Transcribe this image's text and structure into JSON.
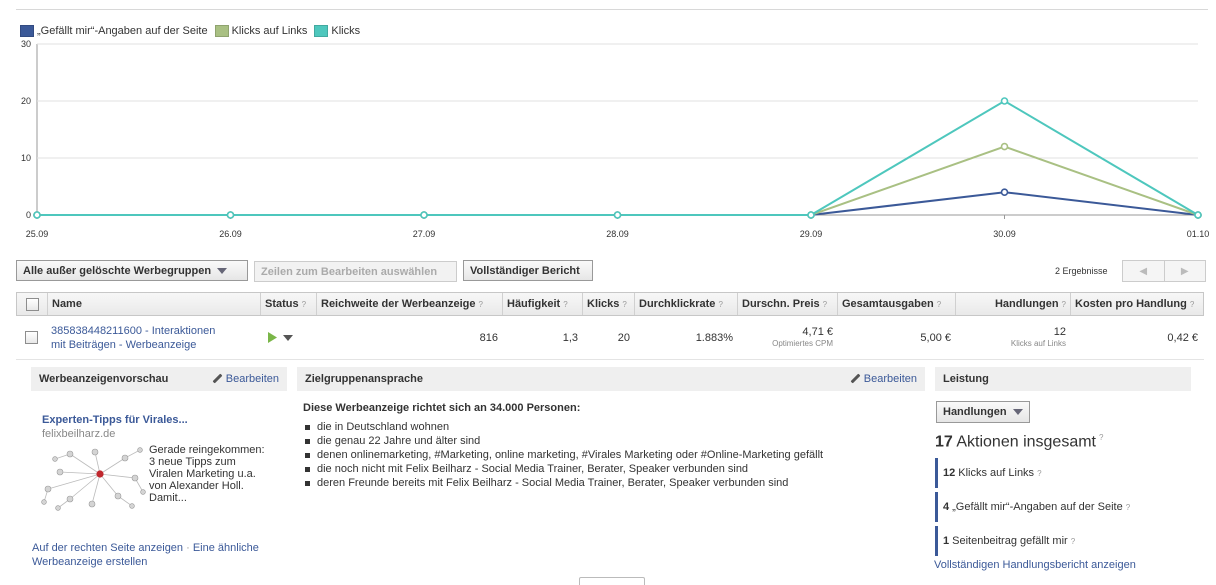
{
  "legend": [
    {
      "label": "„Gefällt mir“-Angaben auf der Seite",
      "color": "#3b5998"
    },
    {
      "label": "Klicks auf Links",
      "color": "#a9c083"
    },
    {
      "label": "Klicks",
      "color": "#4ec7bd"
    }
  ],
  "chart_data": {
    "type": "line",
    "x": [
      "25.09",
      "26.09",
      "27.09",
      "28.09",
      "29.09",
      "30.09",
      "01.10"
    ],
    "yticks": [
      0,
      10,
      20,
      30
    ],
    "ylim": [
      0,
      30
    ],
    "series": [
      {
        "name": "„Gefällt mir“-Angaben auf der Seite",
        "color": "#3b5998",
        "values": [
          0,
          0,
          0,
          0,
          0,
          4,
          0
        ]
      },
      {
        "name": "Klicks auf Links",
        "color": "#a9c083",
        "values": [
          0,
          0,
          0,
          0,
          0,
          12,
          0
        ]
      },
      {
        "name": "Klicks",
        "color": "#4ec7bd",
        "values": [
          0,
          0,
          0,
          0,
          0,
          20,
          0
        ]
      }
    ]
  },
  "toolbar": {
    "filter_label": "Alle außer gelöschte Werbegruppen",
    "select_rows_label": "Zeilen zum Bearbeiten auswählen",
    "full_report_label": "Vollständiger Bericht",
    "results": "2 Ergebnisse",
    "prev": "◀",
    "next": "▶"
  },
  "table": {
    "help": "?",
    "headers": {
      "name": "Name",
      "status": "Status",
      "reach": "Reichweite der Werbeanzeige",
      "frequency": "Häufigkeit",
      "clicks": "Klicks",
      "ctr": "Durchklickrate",
      "avg_price": "Durschn. Preis",
      "spend": "Gesamtausgaben",
      "actions": "Handlungen",
      "cost_per_action": "Kosten pro Handlung"
    },
    "row": {
      "name_line1": "385838448211600 - Interaktionen",
      "name_line2": "mit Beiträgen - Werbeanzeige",
      "reach": "816",
      "frequency": "1,3",
      "clicks": "20",
      "ctr": "1.883%",
      "avg_price": "4,71 €",
      "avg_price_sub": "Optimiertes CPM",
      "spend": "5,00 €",
      "actions": "12",
      "actions_sub": "Klicks auf Links",
      "cost_per_action": "0,42 €"
    }
  },
  "preview": {
    "header": "Werbeanzeigenvorschau",
    "edit": "Bearbeiten",
    "title": "Experten-Tipps für Virales...",
    "url": "felixbeilharz.de",
    "text": "Gerade reingekommen: 3 neue Tipps zum Viralen Marketing u.a. von Alexander Holl. Damit...",
    "link_right": "Auf der rechten Seite anzeigen",
    "separator": "·",
    "link_similar": "Eine ähnliche Werbeanzeige erstellen"
  },
  "targeting": {
    "header": "Zielgruppenansprache",
    "edit": "Bearbeiten",
    "headline": "Diese Werbeanzeige richtet sich an 34.000 Personen:",
    "items": [
      "die in Deutschland wohnen",
      "die genau 22 Jahre und älter sind",
      "denen onlinemarketing, #Marketing, online marketing, #Virales Marketing oder #Online-Marketing gefällt",
      "die noch nicht mit Felix Beilharz - Social Media Trainer, Berater, Speaker verbunden sind",
      "deren Freunde bereits mit Felix Beilharz - Social Media Trainer, Berater, Speaker verbunden sind"
    ]
  },
  "performance": {
    "header": "Leistung",
    "dropdown": "Handlungen",
    "total_number": "17",
    "total_label": "Aktionen insgesamt",
    "bars": [
      {
        "count": "12",
        "label": "Klicks auf Links",
        "value": 12
      },
      {
        "count": "4",
        "label": "„Gefällt mir“-Angaben auf der Seite",
        "value": 4
      },
      {
        "count": "1",
        "label": "Seitenbeitrag gefällt mir",
        "value": 1
      }
    ],
    "full_link": "Vollständigen Handlungsbericht anzeigen"
  }
}
